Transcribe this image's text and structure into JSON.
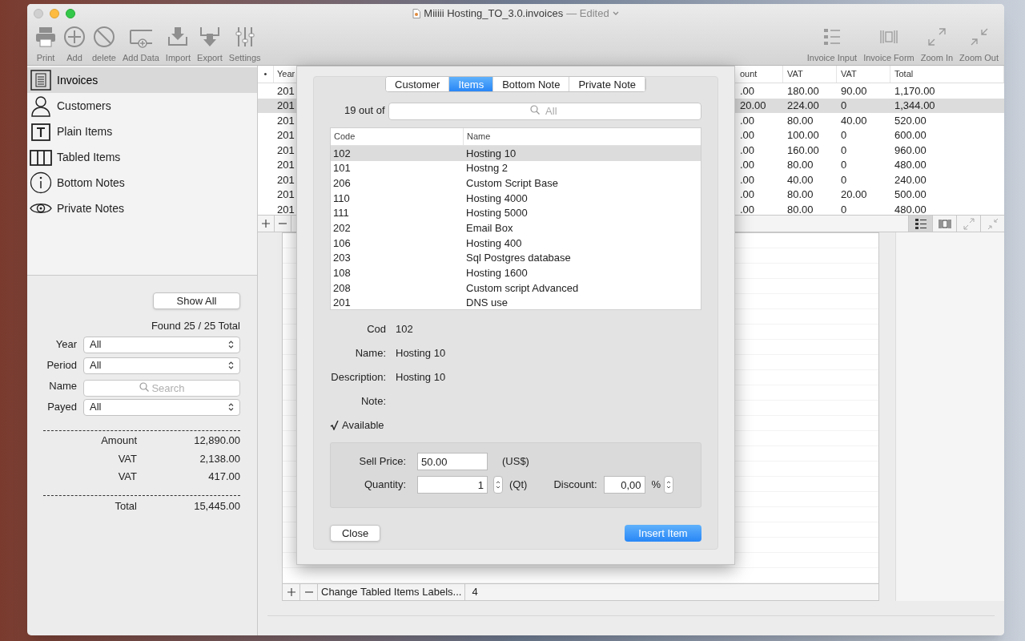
{
  "window": {
    "title": "Miiiii Hosting_TO_3.0.invoices",
    "status": "— Edited"
  },
  "toolbar_left": [
    {
      "kind": "print",
      "label": "Print"
    },
    {
      "kind": "add",
      "label": "Add"
    },
    {
      "kind": "delete",
      "label": "delete"
    },
    {
      "kind": "adddata",
      "label": "Add Data"
    },
    {
      "kind": "import",
      "label": "Import"
    },
    {
      "kind": "export",
      "label": "Export"
    },
    {
      "kind": "settings",
      "label": "Settings"
    }
  ],
  "toolbar_right": [
    {
      "kind": "list",
      "label": "Invoice Input"
    },
    {
      "kind": "form",
      "label": "Invoice Form"
    },
    {
      "kind": "zoomin",
      "label": "Zoom In"
    },
    {
      "kind": "zoomout",
      "label": "Zoom Out"
    }
  ],
  "sidebar": {
    "items": [
      {
        "kind": "invoices",
        "label": "Invoices",
        "selected": true
      },
      {
        "kind": "customers",
        "label": "Customers",
        "selected": false
      },
      {
        "kind": "plain",
        "label": "Plain Items",
        "selected": false
      },
      {
        "kind": "tabled",
        "label": "Tabled Items",
        "selected": false
      },
      {
        "kind": "bottom",
        "label": "Bottom Notes",
        "selected": false
      },
      {
        "kind": "private",
        "label": "Private Notes",
        "selected": false
      }
    ]
  },
  "filters": {
    "show_all": "Show All",
    "found": "Found 25 / 25 Total",
    "fields": [
      {
        "kind": "select",
        "label": "Year",
        "value": "All"
      },
      {
        "kind": "select",
        "label": "Period",
        "value": "All"
      },
      {
        "kind": "search",
        "label": "Name",
        "placeholder": "Search"
      },
      {
        "kind": "select",
        "label": "Payed",
        "value": "All"
      }
    ]
  },
  "summary": {
    "rows": [
      {
        "label": "Amount",
        "value": "12,890.00"
      },
      {
        "label": "VAT",
        "value": "2,138.00"
      },
      {
        "label": "VAT",
        "value": "417.00"
      }
    ],
    "total": {
      "label": "Total",
      "value": "15,445.00"
    }
  },
  "invoices": {
    "marker_column": "•",
    "columns": [
      "Year",
      "ount",
      "VAT",
      "VAT",
      "Total"
    ],
    "rows": [
      {
        "selected": false,
        "cells": [
          "201",
          ".00",
          "180.00",
          "90.00",
          "1,170.00"
        ]
      },
      {
        "selected": true,
        "cells": [
          "201",
          "20.00",
          "224.00",
          "0",
          "1,344.00"
        ]
      },
      {
        "selected": false,
        "cells": [
          "201",
          ".00",
          "80.00",
          "40.00",
          "520.00"
        ]
      },
      {
        "selected": false,
        "cells": [
          "201",
          ".00",
          "100.00",
          "0",
          "600.00"
        ]
      },
      {
        "selected": false,
        "cells": [
          "201",
          ".00",
          "160.00",
          "0",
          "960.00"
        ]
      },
      {
        "selected": false,
        "cells": [
          "201",
          ".00",
          "80.00",
          "0",
          "480.00"
        ]
      },
      {
        "selected": false,
        "cells": [
          "201",
          ".00",
          "40.00",
          "0",
          "240.00"
        ]
      },
      {
        "selected": false,
        "cells": [
          "201",
          ".00",
          "80.00",
          "20.00",
          "500.00"
        ]
      },
      {
        "selected": false,
        "cells": [
          "201",
          ".00",
          "80.00",
          "0",
          "480.00"
        ]
      }
    ],
    "view_buttons": [
      {
        "kind": "list",
        "selected": true
      },
      {
        "kind": "form",
        "selected": false
      },
      {
        "kind": "zoomin",
        "selected": false
      },
      {
        "kind": "zoomout",
        "selected": false
      }
    ]
  },
  "tabled_items": {
    "labels_button": "Change Tabled Items Labels...",
    "count": "4"
  },
  "sheet": {
    "tabs": [
      {
        "label": "Customer",
        "selected": false
      },
      {
        "label": "Items",
        "selected": true
      },
      {
        "label": "Bottom Note",
        "selected": false
      },
      {
        "label": "Private Note",
        "selected": false
      }
    ],
    "count": "19 out of",
    "search_placeholder": "All",
    "columns": [
      "Code",
      "Name"
    ],
    "items": [
      {
        "code": "102",
        "name": "Hosting 10",
        "selected": true
      },
      {
        "code": "101",
        "name": "Hostng 2",
        "selected": false
      },
      {
        "code": "206",
        "name": "Custom Script Base",
        "selected": false
      },
      {
        "code": "110",
        "name": "Hosting 4000",
        "selected": false
      },
      {
        "code": "111",
        "name": "Hosting 5000",
        "selected": false
      },
      {
        "code": "202",
        "name": "Email Box",
        "selected": false
      },
      {
        "code": "106",
        "name": "Hosting 400",
        "selected": false
      },
      {
        "code": "203",
        "name": "Sql Postgres database",
        "selected": false
      },
      {
        "code": "108",
        "name": "Hosting 1600",
        "selected": false
      },
      {
        "code": "208",
        "name": "Custom script Advanced",
        "selected": false
      },
      {
        "code": "201",
        "name": "DNS use",
        "selected": false
      }
    ],
    "details": [
      {
        "label": "Cod",
        "value": "102"
      },
      {
        "label": "Name:",
        "value": "Hosting 10"
      },
      {
        "label": "Description:",
        "value": "Hosting 10"
      },
      {
        "label": "Note:"
      }
    ],
    "available": {
      "label": "Available",
      "checked": true
    },
    "sell_price": {
      "label": "Sell Price:",
      "value": "50.00",
      "unit": "(US$)"
    },
    "quantity": {
      "label": "Quantity:",
      "value": "1",
      "unit": "(Qt)"
    },
    "discount": {
      "label": "Discount:",
      "value": "0,00",
      "unit": "%"
    },
    "close": "Close",
    "insert": "Insert Item"
  }
}
